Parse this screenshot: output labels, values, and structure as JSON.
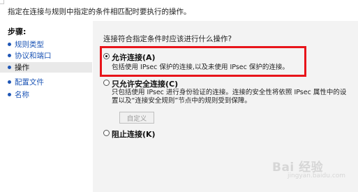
{
  "header": {
    "description": "指定在连接与规则中指定的条件相匹配时要执行的操作。"
  },
  "steps": {
    "title": "步骤:",
    "items": [
      {
        "label": "规则类型"
      },
      {
        "label": "协议和端口"
      },
      {
        "label": "操作"
      },
      {
        "label": "配置文件"
      },
      {
        "label": "名称"
      }
    ]
  },
  "main": {
    "question": "连接符合指定条件时应该进行什么操作?",
    "options": [
      {
        "label": "允许连接(A)",
        "desc": [
          "包括使用 IPsec 保护的连接,以及未使用 IPsec 保护的连接。"
        ],
        "selected": true
      },
      {
        "label": "只允许安全连接(C)",
        "desc": [
          "只包括使用 IPsec 进行身份验证的连接。连接的安全性将依照 IPsec 属性中的设",
          "置以及“连接安全规则”节点中的规则受到保障。"
        ],
        "selected": false
      },
      {
        "label": "阻止连接(K)",
        "desc": [],
        "selected": false
      }
    ],
    "custom_button": "自定义"
  },
  "watermark": {
    "text": "Bai 经验",
    "sub": "jingyan.baidu.com"
  },
  "colors": {
    "link": "#1e56b6",
    "highlight_border": "#e8141a",
    "main_bg": "#f3f3f3",
    "active_step_bg": "#e9e9e9"
  }
}
